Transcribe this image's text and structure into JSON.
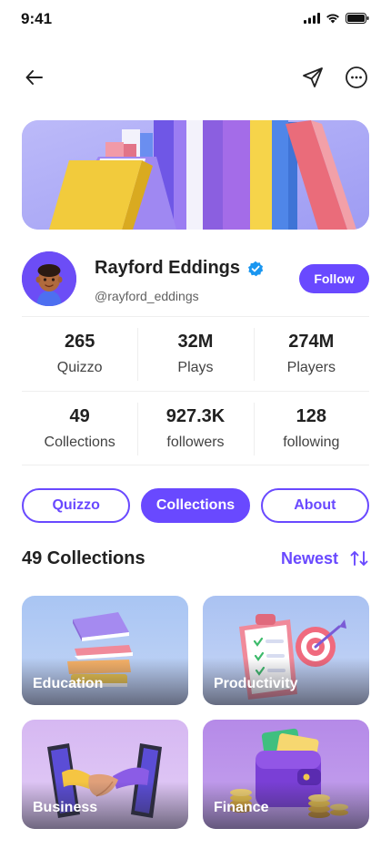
{
  "status_bar": {
    "time": "9:41"
  },
  "topbar": {
    "back_icon": "arrow-left-icon",
    "share_icon": "send-icon",
    "more_icon": "more-circle-icon"
  },
  "profile": {
    "name": "Rayford Eddings",
    "handle": "@rayford_eddings",
    "verified": true,
    "follow_label": "Follow"
  },
  "stats": [
    [
      {
        "value": "265",
        "label": "Quizzo"
      },
      {
        "value": "32M",
        "label": "Plays"
      },
      {
        "value": "274M",
        "label": "Players"
      }
    ],
    [
      {
        "value": "49",
        "label": "Collections"
      },
      {
        "value": "927.3K",
        "label": "followers"
      },
      {
        "value": "128",
        "label": "following"
      }
    ]
  ],
  "tabs": [
    {
      "label": "Quizzo",
      "active": false
    },
    {
      "label": "Collections",
      "active": true
    },
    {
      "label": "About",
      "active": false
    }
  ],
  "section": {
    "title": "49 Collections",
    "sort_label": "Newest",
    "sort_icon": "swap-vertical-icon"
  },
  "collections": [
    {
      "label": "Education"
    },
    {
      "label": "Productivity"
    },
    {
      "label": "Business"
    },
    {
      "label": "Finance"
    }
  ],
  "colors": {
    "primary": "#6949ff",
    "verified": "#1a96f0",
    "text": "#212121"
  }
}
